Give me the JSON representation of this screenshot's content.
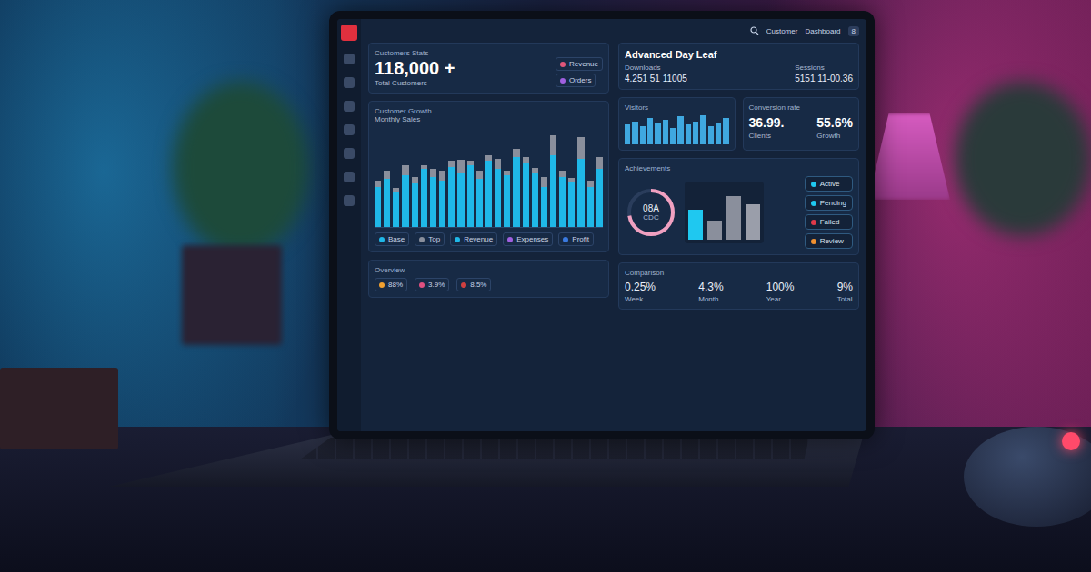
{
  "header": {
    "links": [
      "Customer",
      "Dashboard"
    ],
    "badge": "8"
  },
  "sidebar": {
    "items": [
      {
        "selected": true
      },
      {
        "selected": false
      },
      {
        "selected": false
      },
      {
        "selected": false
      },
      {
        "selected": false
      },
      {
        "selected": false
      },
      {
        "selected": false
      },
      {
        "selected": false
      }
    ]
  },
  "kpi": {
    "title": "Customers Stats",
    "value": "118,000 +",
    "caption": "Total Customers",
    "legend": [
      {
        "label": "Revenue",
        "color": "#e0567a"
      },
      {
        "label": "Orders",
        "color": "#a060e0"
      }
    ]
  },
  "summary": {
    "title": "Advanced Day Leaf",
    "items": [
      {
        "caption": "Downloads",
        "value": "4.251 51 11005"
      },
      {
        "caption": "Sessions",
        "value": "5151 11-00.36"
      }
    ]
  },
  "growth_chart": {
    "title": "Customer Growth",
    "subtitle": "Monthly Sales",
    "series": [
      {
        "name": "Base",
        "color": "#1fb8e8",
        "values": [
          40,
          48,
          35,
          52,
          44,
          58,
          50,
          46,
          60,
          55,
          62,
          48,
          66,
          58,
          52,
          70,
          64,
          55,
          40,
          72,
          50,
          45,
          68,
          40,
          58
        ]
      },
      {
        "name": "Top",
        "color": "#8a8f9c",
        "values": [
          6,
          8,
          4,
          10,
          6,
          4,
          8,
          10,
          6,
          12,
          4,
          8,
          6,
          10,
          4,
          8,
          6,
          4,
          10,
          20,
          6,
          4,
          22,
          6,
          12
        ]
      }
    ],
    "legend": [
      {
        "label": "Revenue",
        "color": "#1fb8e8"
      },
      {
        "label": "Expenses",
        "color": "#a060e0"
      },
      {
        "label": "Profit",
        "color": "#3a7ae0"
      }
    ]
  },
  "mini_chart": {
    "title": "Visitors",
    "values": [
      60,
      70,
      55,
      80,
      65,
      75,
      50,
      85,
      60,
      70,
      90,
      55,
      65,
      80
    ]
  },
  "rates": {
    "title": "Conversion rate",
    "items": [
      {
        "value": "36.99.",
        "caption": "Clients"
      },
      {
        "value": "55.6%",
        "caption": "Growth"
      }
    ]
  },
  "activity": {
    "title": "Achievements",
    "gauge": {
      "label": "08A",
      "sub": "CDC",
      "level": 0.72
    },
    "bars": [
      {
        "value": 55,
        "color": "#1fc8f0"
      },
      {
        "value": 35,
        "color": "#8a8f9c"
      },
      {
        "value": 80,
        "color": "#8a8f9c"
      },
      {
        "value": 65,
        "color": "#9a9eaa"
      }
    ],
    "pills": [
      {
        "label": "Active",
        "color": "#1fc8f0"
      },
      {
        "label": "Pending",
        "color": "#1fc8f0"
      },
      {
        "label": "Failed",
        "color": "#e03a4a"
      },
      {
        "label": "Review",
        "color": "#f09030"
      }
    ]
  },
  "bottom_left": {
    "title": "Overview",
    "cards": [
      {
        "value": "88%",
        "color": "#f0a030"
      },
      {
        "value": "3.9%",
        "color": "#e05080"
      },
      {
        "value": "8.5%",
        "color": "#d04040"
      }
    ]
  },
  "bottom_right": {
    "title": "Comparison",
    "items": [
      {
        "value": "0.25%",
        "caption": "Week"
      },
      {
        "value": "4.3%",
        "caption": "Month"
      },
      {
        "value": "100%",
        "caption": "Year"
      },
      {
        "value": "9%",
        "caption": "Total"
      }
    ]
  }
}
